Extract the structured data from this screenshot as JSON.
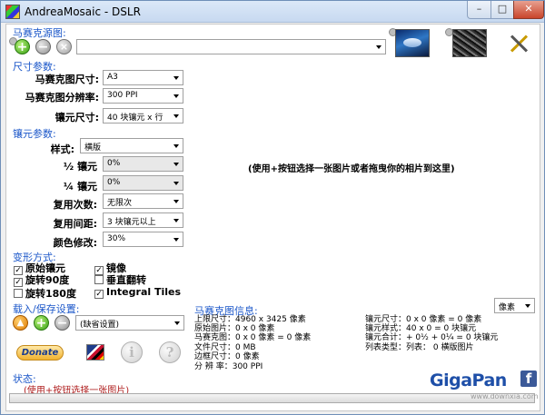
{
  "window": {
    "title": "AndreaMosaic - DSLR",
    "min_label": "–",
    "max_label": "□",
    "close_label": "✕"
  },
  "source": {
    "section_label": "马赛克源图:",
    "path_value": "",
    "drop_hint": "(使用+按钮选择一张图片或者拖曳你的相片到这里)"
  },
  "size": {
    "section_label": "尺寸参数:",
    "mosaic_size_label": "马赛克图尺寸:",
    "mosaic_size_value": "A3",
    "resolution_label": "马赛克图分辨率:",
    "resolution_value": "300 PPI",
    "tile_size_label": "镶元尺寸:",
    "tile_size_value": "40 块镶元 x 行"
  },
  "tile": {
    "section_label": "镶元参数:",
    "style_label": "样式:",
    "style_value": "横版",
    "half_label": "½ 镶元",
    "half_value": "0%",
    "quarter_label": "¼ 镶元",
    "quarter_value": "0%",
    "reuse_label": "复用次数:",
    "reuse_value": "无限次",
    "reuse_distance_label": "复用间距:",
    "reuse_distance_value": "3 块镶元以上",
    "color_label": "颜色修改:",
    "color_value": "30%"
  },
  "transform": {
    "section_label": "变形方式:",
    "options": [
      {
        "label": "原始镶元",
        "checked": true
      },
      {
        "label": "镜像",
        "checked": true
      },
      {
        "label": "旋转90度",
        "checked": true
      },
      {
        "label": "垂直翻转",
        "checked": false
      },
      {
        "label": "旋转180度",
        "checked": false
      },
      {
        "label": "Integral Tiles",
        "checked": true
      }
    ]
  },
  "load_save": {
    "section_label": "载入/保存设置:",
    "preset_value": "(缺省设置)"
  },
  "info": {
    "section_label": "马赛克图信息:",
    "unit_value": "像素",
    "left": [
      "上限尺寸：4960 x 3425 像素",
      "原始图片：0 x 0 像素",
      "马赛克图：0 x 0 像素 = 0 像素",
      "文件尺寸：0 MB",
      "边框尺寸：0 像素",
      "分 辨 率：300 PPI"
    ],
    "right": [
      "镶元尺寸：0 x 0 像素 = 0 像素",
      "镶元样式：40 x 0 = 0 块镶元",
      "镶元合计：+ 0½ + 0¼ = 0 块镶元",
      "列表类型：列表： 0 横版图片"
    ]
  },
  "footer": {
    "donate_label": "Donate",
    "status_label": "状态:",
    "status_text": "(使用+按钮选择一张图片)",
    "gigapan_label": "GigaPan",
    "watermark": "www.downxia.com"
  },
  "icons": {
    "plus": "+",
    "minus": "−",
    "close": "×",
    "up": "▲",
    "info": "i",
    "help": "?",
    "facebook": "f"
  }
}
